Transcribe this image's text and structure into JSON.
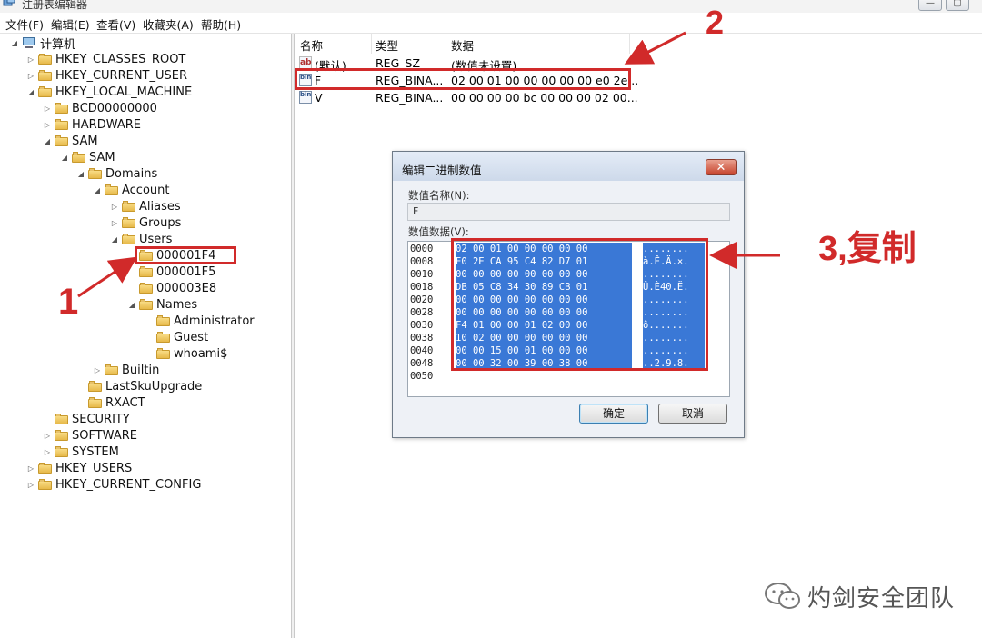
{
  "window": {
    "title": "注册表编辑器",
    "minimize": "—",
    "maximize": "▢"
  },
  "menu": [
    "文件(F)",
    "编辑(E)",
    "查看(V)",
    "收藏夹(A)",
    "帮助(H)"
  ],
  "tree": [
    {
      "label": "计算机",
      "expander": "◢",
      "icon": "computer"
    },
    {
      "label": "HKEY_CLASSES_ROOT",
      "expander": "▷"
    },
    {
      "label": "HKEY_CURRENT_USER",
      "expander": "▷"
    },
    {
      "label": "HKEY_LOCAL_MACHINE",
      "expander": "◢"
    },
    {
      "label": "BCD00000000",
      "expander": "▷"
    },
    {
      "label": "HARDWARE",
      "expander": "▷"
    },
    {
      "label": "SAM",
      "expander": "◢"
    },
    {
      "label": "SAM",
      "expander": "◢"
    },
    {
      "label": "Domains",
      "expander": "◢"
    },
    {
      "label": "Account",
      "expander": "◢"
    },
    {
      "label": "Aliases",
      "expander": "▷"
    },
    {
      "label": "Groups",
      "expander": "▷"
    },
    {
      "label": "Users",
      "expander": "◢"
    },
    {
      "label": "000001F4",
      "expander": ""
    },
    {
      "label": "000001F5",
      "expander": ""
    },
    {
      "label": "000003E8",
      "expander": ""
    },
    {
      "label": "Names",
      "expander": "◢"
    },
    {
      "label": "Administrator",
      "expander": ""
    },
    {
      "label": "Guest",
      "expander": ""
    },
    {
      "label": "whoami$",
      "expander": ""
    },
    {
      "label": "Builtin",
      "expander": "▷"
    },
    {
      "label": "LastSkuUpgrade",
      "expander": ""
    },
    {
      "label": "RXACT",
      "expander": ""
    },
    {
      "label": "SECURITY",
      "expander": ""
    },
    {
      "label": "SOFTWARE",
      "expander": "▷"
    },
    {
      "label": "SYSTEM",
      "expander": "▷"
    },
    {
      "label": "HKEY_USERS",
      "expander": "▷"
    },
    {
      "label": "HKEY_CURRENT_CONFIG",
      "expander": "▷"
    }
  ],
  "list": {
    "headers": {
      "name": "名称",
      "type": "类型",
      "data": "数据"
    },
    "rows": [
      {
        "icon": "ab",
        "name": "(默认)",
        "type": "REG_SZ",
        "data": "(数值未设置)"
      },
      {
        "icon": "bin",
        "name": "F",
        "type": "REG_BINA...",
        "data": "02 00 01 00 00 00 00 00 e0 2e..."
      },
      {
        "icon": "bin",
        "name": "V",
        "type": "REG_BINA...",
        "data": "00 00 00 00 bc 00 00 00 02 00..."
      }
    ]
  },
  "dialog": {
    "title": "编辑二进制数值",
    "close": "✕",
    "name_label": "数值名称(N):",
    "name_value": "F",
    "data_label": "数值数据(V):",
    "hex_rows": [
      {
        "offset": "0000",
        "bytes": "02 00 01 00 00 00 00 00",
        "ascii": "........"
      },
      {
        "offset": "0008",
        "bytes": "E0 2E CA 95 C4 82 D7 01",
        "ascii": "à.Ê.Ä.×."
      },
      {
        "offset": "0010",
        "bytes": "00 00 00 00 00 00 00 00",
        "ascii": "........"
      },
      {
        "offset": "0018",
        "bytes": "DB 05 C8 34 30 89 CB 01",
        "ascii": "Û.È40.Ë."
      },
      {
        "offset": "0020",
        "bytes": "00 00 00 00 00 00 00 00",
        "ascii": "........"
      },
      {
        "offset": "0028",
        "bytes": "00 00 00 00 00 00 00 00",
        "ascii": "........"
      },
      {
        "offset": "0030",
        "bytes": "F4 01 00 00 01 02 00 00",
        "ascii": "ô......."
      },
      {
        "offset": "0038",
        "bytes": "10 02 00 00 00 00 00 00",
        "ascii": "........"
      },
      {
        "offset": "0040",
        "bytes": "00 00 15 00 01 00 00 00",
        "ascii": "........"
      },
      {
        "offset": "0048",
        "bytes": "00 00 32 00 39 00 38 00",
        "ascii": "..2.9.8."
      },
      {
        "offset": "0050",
        "bytes": "",
        "ascii": ""
      }
    ],
    "ok": "确定",
    "cancel": "取消"
  },
  "annotations": {
    "step1": "1",
    "step2": "2",
    "step3": "3,复制",
    "color": "#d12a2a"
  },
  "watermark": {
    "text": "灼剑安全团队"
  }
}
